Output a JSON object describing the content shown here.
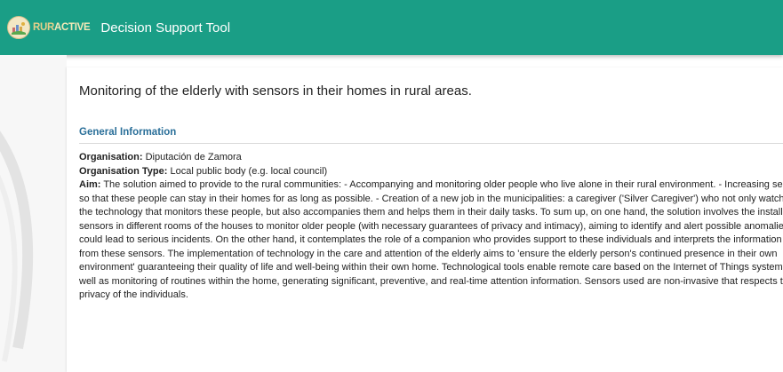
{
  "header": {
    "logo_prefix": "RUR",
    "logo_suffix": "ACTIVE",
    "title": "Decision Support Tool",
    "bar_color": "#1a9e86",
    "logo_icon": "rural-landscape-icon"
  },
  "page": {
    "title": "Monitoring of the elderly with sensors in their homes in rural areas."
  },
  "general_information": {
    "heading": "General Information",
    "organisation_label": "Organisation:",
    "organisation_value": "Diputación de Zamora",
    "organisation_type_label": "Organisation Type:",
    "organisation_type_value": "Local public body (e.g. local council)",
    "aim_label": "Aim:",
    "aim_value": "The solution aimed to provide to the rural communities: - Accompanying and monitoring older people who live alone in their rural environment. - Increasing security so that these people can stay in their homes for as long as possible. - Creation of a new job in the municipalities: a caregiver ('Silver Caregiver') who not only watches over the technology that monitors these people, but also accompanies them and helps them in their daily tasks. To sum up, on one hand, the solution involves the installation of sensors in different rooms of the houses to monitor older people (with necessary guarantees of privacy and intimacy), aiming to identify and alert possible anomalies that could lead to serious incidents. On the other hand, it contemplates the role of a companion who provides support to these individuals and interprets the information coming from these sensors. The implementation of technology in the care and attention of the elderly aims to 'ensure the elderly person's continued presence in their own environment' guaranteeing their quality of life and well-being within their own home. Technological tools enable remote care based on the Internet of Things system, as well as monitoring of routines within the home, generating significant, preventive, and real-time attention information. Sensors used are non-invasive that respects the privacy of the individuals."
  }
}
